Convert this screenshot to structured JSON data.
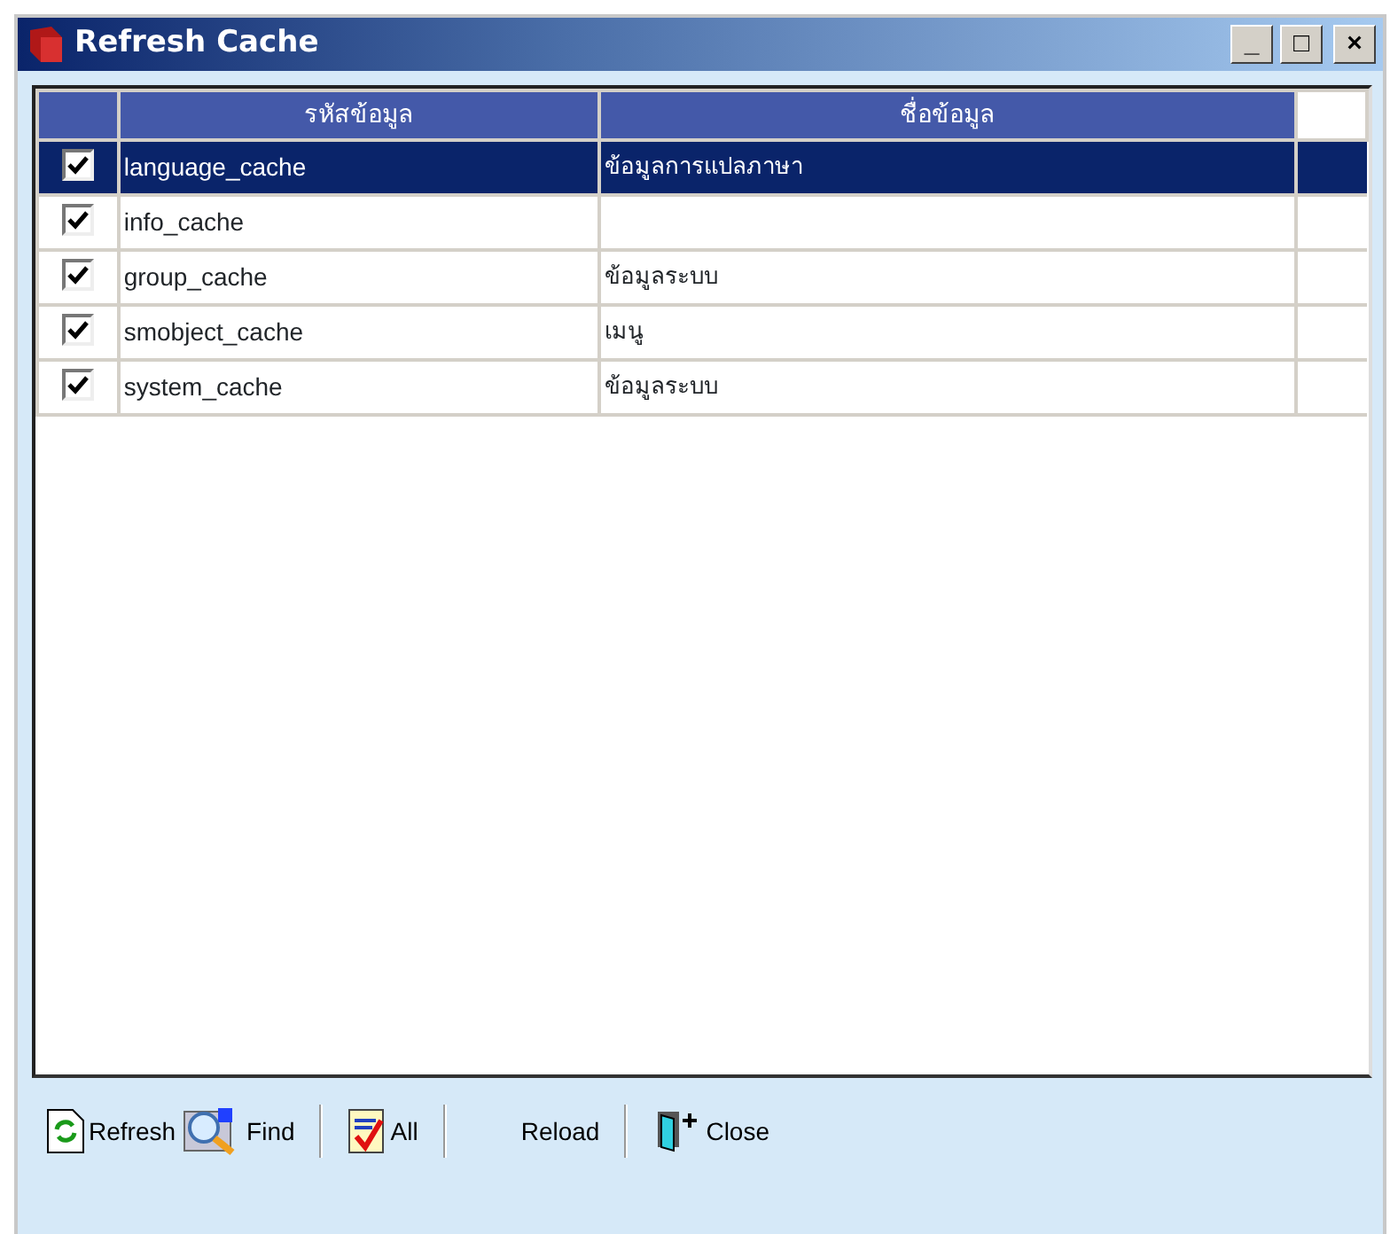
{
  "window": {
    "title": "Refresh Cache",
    "controls": [
      "_",
      "□",
      "×"
    ]
  },
  "table": {
    "columns": [
      "รหัสข้อมูล",
      "ชื่อข้อมูล"
    ],
    "rows": [
      {
        "checked": true,
        "selected": true,
        "code": "language_cache",
        "name": "ข้อมูลการแปลภาษา"
      },
      {
        "checked": true,
        "selected": false,
        "code": "info_cache"
      },
      {
        "checked": true,
        "selected": false,
        "code": "group_cache",
        "name": "ข้อมูลระบบ"
      },
      {
        "checked": true,
        "selected": false,
        "code": "smobject_cache",
        "name": "เมนู"
      },
      {
        "checked": true,
        "selected": false,
        "code": "system_cache",
        "name": "ข้อมูลระบบ"
      }
    ]
  },
  "toolbar": [
    {
      "kind": "button",
      "label": "Refresh"
    },
    {
      "kind": "button",
      "label": "Find"
    },
    {
      "kind": "separator"
    },
    {
      "kind": "button",
      "label": "All"
    },
    {
      "kind": "separator"
    },
    {
      "kind": "button",
      "label": "Reload"
    },
    {
      "kind": "separator"
    },
    {
      "kind": "button",
      "label": "Close"
    }
  ]
}
